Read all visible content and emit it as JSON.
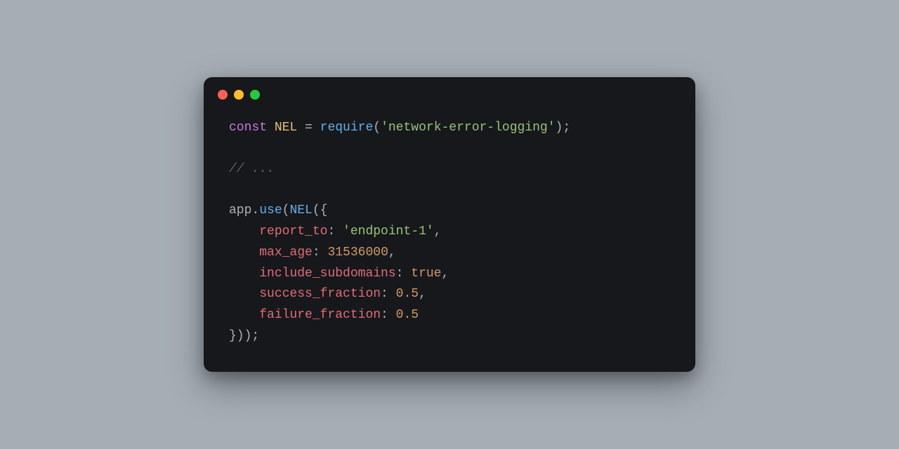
{
  "traffic_lights": {
    "red": "#ff5f56",
    "yellow": "#ffbd2e",
    "green": "#27c93f"
  },
  "code": {
    "l1": {
      "kw_const": "const",
      "var_nel": "NEL",
      "eq": " = ",
      "fn_require": "require",
      "paren_open": "(",
      "str_module": "'network-error-logging'",
      "paren_close_semi": ");"
    },
    "l2_blank": "",
    "l3_comment": "// ...",
    "l4_blank": "",
    "l5": {
      "plain_app": "app",
      "dot1": ".",
      "fn_use": "use",
      "paren_open": "(",
      "fn_nel": "NEL",
      "open_obj": "({"
    },
    "l6": {
      "indent": "    ",
      "prop": "report_to",
      "colon": ": ",
      "str_val": "'endpoint-1'",
      "comma": ","
    },
    "l7": {
      "indent": "    ",
      "prop": "max_age",
      "colon": ": ",
      "num_val": "31536000",
      "comma": ","
    },
    "l8": {
      "indent": "    ",
      "prop": "include_subdomains",
      "colon": ": ",
      "bool_val": "true",
      "comma": ","
    },
    "l9": {
      "indent": "    ",
      "prop": "success_fraction",
      "colon": ": ",
      "num_val": "0.5",
      "comma": ","
    },
    "l10": {
      "indent": "    ",
      "prop": "failure_fraction",
      "colon": ": ",
      "num_val": "0.5"
    },
    "l11_close": "}));"
  }
}
